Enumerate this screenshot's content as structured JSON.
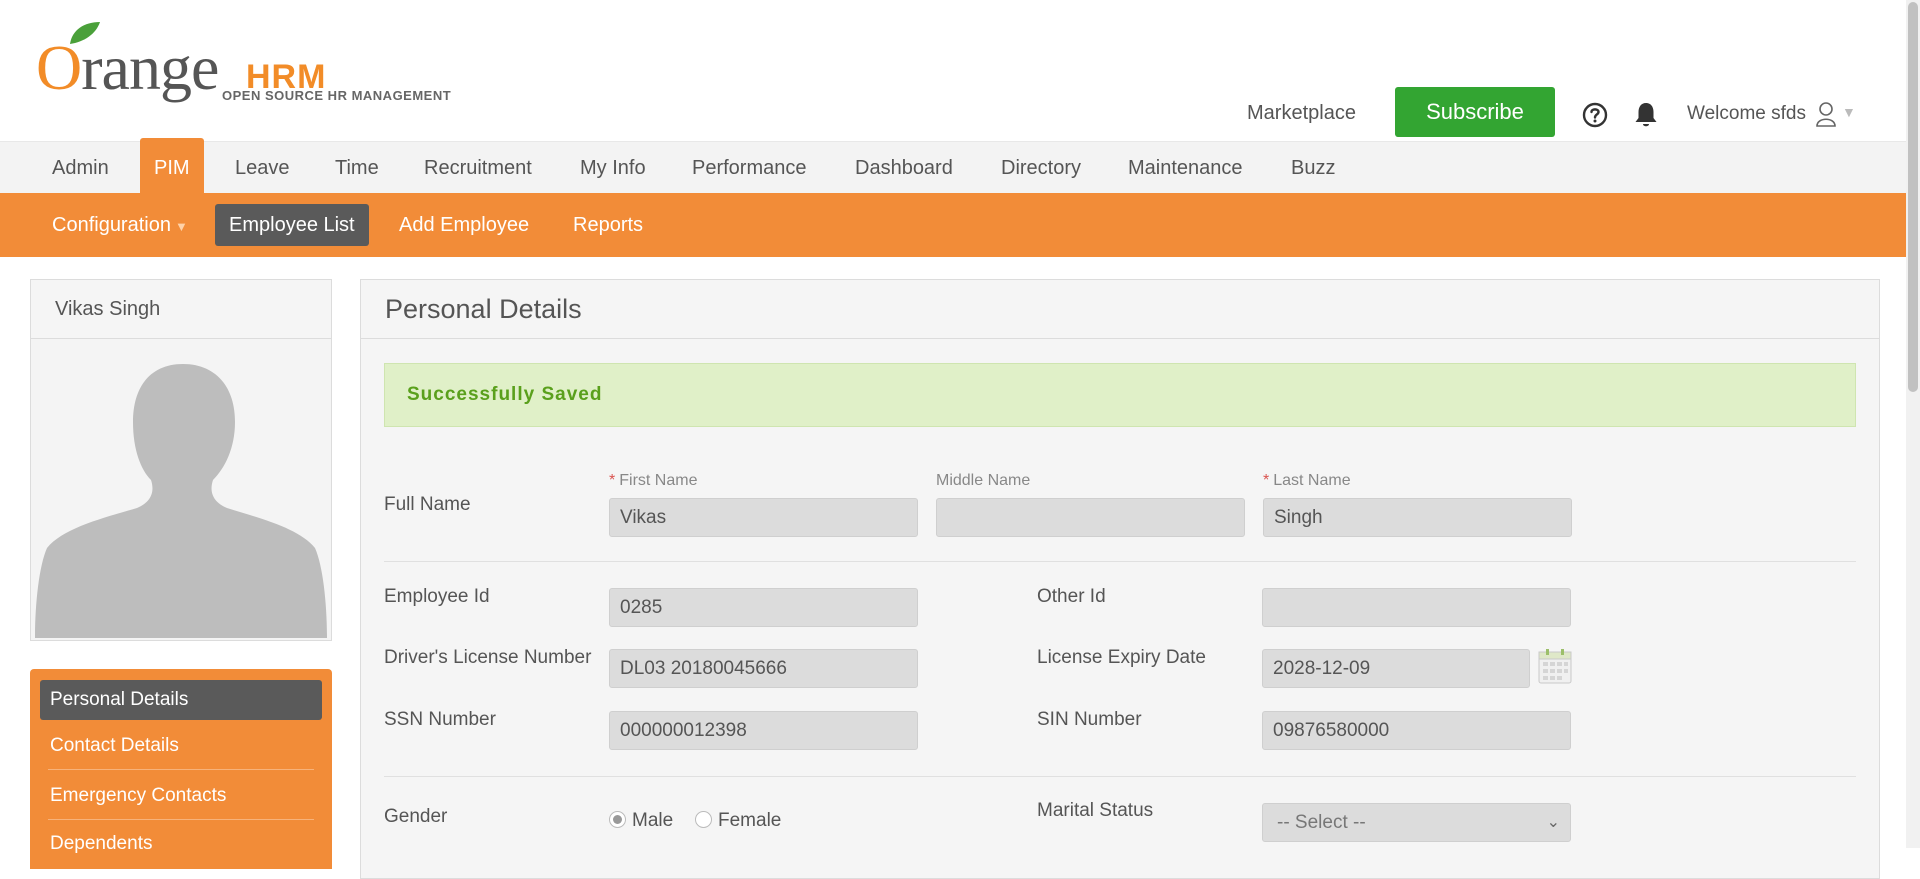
{
  "header": {
    "logo_word_first": "O",
    "logo_word_rest": "range",
    "logo_hrm": "HRM",
    "logo_tagline": "OPEN SOURCE HR MANAGEMENT",
    "marketplace": "Marketplace",
    "subscribe": "Subscribe",
    "welcome": "Welcome sfds",
    "help_icon": "help-circle-icon",
    "bell_icon": "bell-icon",
    "user_icon": "user-icon"
  },
  "main_menu": [
    {
      "label": "Admin",
      "active": false
    },
    {
      "label": "PIM",
      "active": true
    },
    {
      "label": "Leave",
      "active": false
    },
    {
      "label": "Time",
      "active": false
    },
    {
      "label": "Recruitment",
      "active": false
    },
    {
      "label": "My Info",
      "active": false
    },
    {
      "label": "Performance",
      "active": false
    },
    {
      "label": "Dashboard",
      "active": false
    },
    {
      "label": "Directory",
      "active": false
    },
    {
      "label": "Maintenance",
      "active": false
    },
    {
      "label": "Buzz",
      "active": false
    }
  ],
  "sub_menu": [
    {
      "label": "Configuration",
      "active": false
    },
    {
      "label": "Employee List",
      "active": true
    },
    {
      "label": "Add Employee",
      "active": false
    },
    {
      "label": "Reports",
      "active": false
    }
  ],
  "profile": {
    "name": "Vikas Singh"
  },
  "side_menu": [
    {
      "label": "Personal Details",
      "active": true
    },
    {
      "label": "Contact Details",
      "active": false
    },
    {
      "label": "Emergency Contacts",
      "active": false
    },
    {
      "label": "Dependents",
      "active": false
    }
  ],
  "panel": {
    "title": "Personal Details",
    "success_message": "Successfully Saved",
    "full_name_label": "Full Name",
    "first_name_label": "First Name",
    "middle_name_label": "Middle Name",
    "last_name_label": "Last Name",
    "required_mark": "*",
    "first_name": "Vikas",
    "middle_name": "",
    "last_name": "Singh",
    "employee_id_label": "Employee Id",
    "employee_id": "0285",
    "other_id_label": "Other Id",
    "other_id": "",
    "license_label": "Driver's License Number",
    "license": "DL03 20180045666",
    "license_expiry_label": "License Expiry Date",
    "license_expiry": "2028-12-09",
    "ssn_label": "SSN Number",
    "ssn": "000000012398",
    "sin_label": "SIN Number",
    "sin": "09876580000",
    "gender_label": "Gender",
    "gender_male": "Male",
    "gender_female": "Female",
    "gender_selected": "Male",
    "marital_label": "Marital Status",
    "marital_value": "-- Select --"
  },
  "colors": {
    "brand_orange": "#f28c38",
    "subscribe_green": "#33a532",
    "active_dark": "#5a5a5a",
    "success_bg": "#e0f0c8",
    "success_text": "#5aa01c"
  }
}
